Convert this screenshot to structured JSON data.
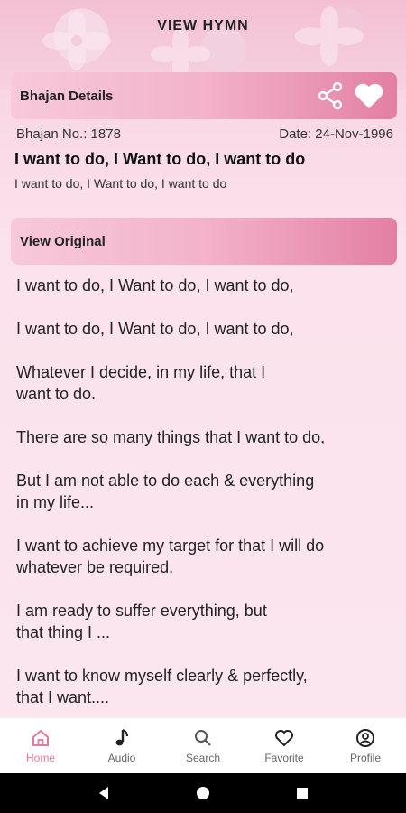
{
  "header": {
    "title": "VIEW HYMN"
  },
  "details": {
    "label": "Bhajan Details",
    "number": "Bhajan No.: 1878",
    "date": "Date: 24-Nov-1996",
    "title": "I want to do, I Want to do, I want to do",
    "subtitle": "I want to do, I Want to do, I want to do"
  },
  "original": {
    "label": "View Original"
  },
  "lyrics": [
    "I want to do, I Want to do, I want to do,",
    "I want to do, I Want to do, I want to do,",
    "Whatever I decide, in my life, that I\nwant to do.",
    "There are so many things that I want to do,",
    "But I am not able to do each & everything\nin my life...",
    "I want to achieve my target for that I will do\nwhatever be required.",
    "I am ready to suffer everything, but\nthat thing I ...",
    "I want to know myself clearly & perfectly,\nthat I want...."
  ],
  "nav": {
    "home": "Home",
    "audio": "Audio",
    "search": "Search",
    "favorite": "Favorite",
    "profile": "Profile"
  },
  "colors": {
    "accent": "#e57aa0",
    "bar_end": "#e37fa2"
  }
}
